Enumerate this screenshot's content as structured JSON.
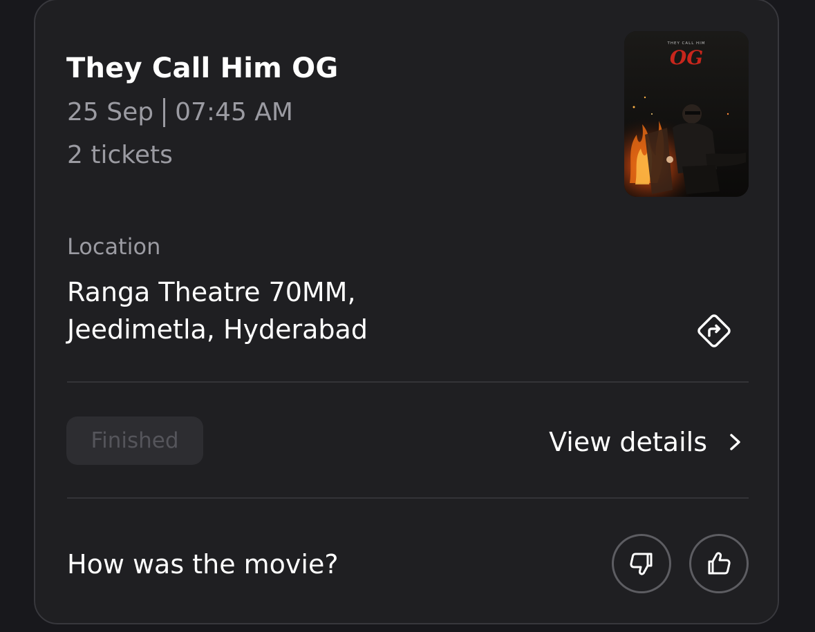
{
  "booking": {
    "title": "They Call Him OG",
    "date": "25 Sep",
    "time": "07:45 AM",
    "tickets": "2 tickets",
    "poster": {
      "tagline": "THEY CALL HIM",
      "logo": "OG"
    }
  },
  "location": {
    "label": "Location",
    "line1": "Ranga Theatre 70MM,",
    "line2": "Jeedimetla, Hyderabad",
    "directions_icon": "directions-icon"
  },
  "status": {
    "label": "Finished"
  },
  "actions": {
    "view_details": "View details",
    "chevron_icon": "chevron-right-icon"
  },
  "feedback": {
    "question": "How was the movie?",
    "dislike_icon": "thumbs-down-icon",
    "like_icon": "thumbs-up-icon"
  },
  "colors": {
    "background": "#18181c",
    "card": "#1f1f22",
    "text_primary": "#ffffff",
    "text_secondary": "#9b9ba2",
    "badge_bg": "#2d2d31",
    "badge_text": "#55555b",
    "poster_logo": "#c8261c"
  }
}
